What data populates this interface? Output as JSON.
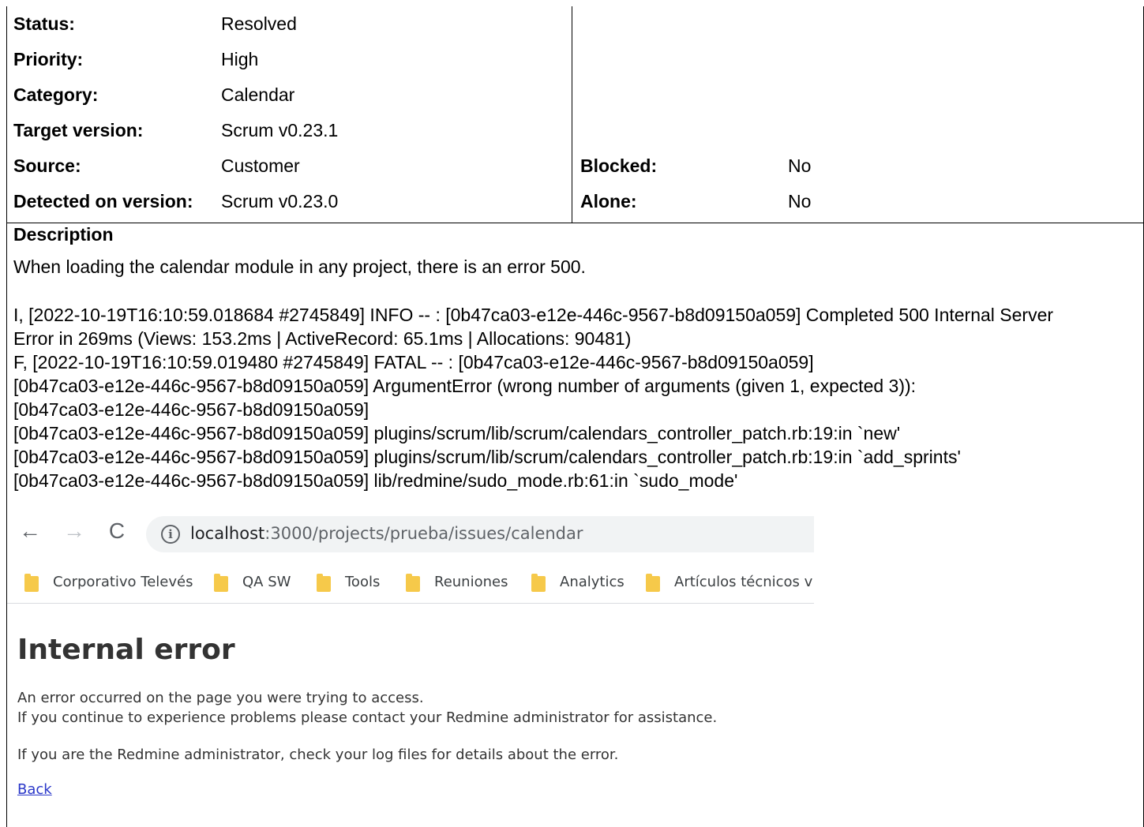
{
  "attributes_left": [
    {
      "label": "Status:",
      "value": "Resolved"
    },
    {
      "label": "Priority:",
      "value": "High"
    },
    {
      "label": "Category:",
      "value": "Calendar"
    },
    {
      "label": "Target version:",
      "value": "Scrum v0.23.1"
    },
    {
      "label": "Source:",
      "value": "Customer"
    },
    {
      "label": "Detected on version:",
      "value": "Scrum v0.23.0"
    }
  ],
  "attributes_right": [
    {
      "label": "Blocked:",
      "value": "No"
    },
    {
      "label": "Alone:",
      "value": "No"
    }
  ],
  "description": {
    "title": "Description",
    "intro": "When loading the calendar module in any project, there is an error 500.",
    "log_lines": [
      "I, [2022-10-19T16:10:59.018684 #2745849]  INFO -- : [0b47ca03-e12e-446c-9567-b8d09150a059] Completed 500 Internal Server",
      "Error in 269ms (Views: 153.2ms | ActiveRecord: 65.1ms | Allocations: 90481)",
      "F, [2022-10-19T16:10:59.019480 #2745849] FATAL -- : [0b47ca03-e12e-446c-9567-b8d09150a059]",
      "[0b47ca03-e12e-446c-9567-b8d09150a059] ArgumentError (wrong number of arguments (given 1, expected 3)):",
      "[0b47ca03-e12e-446c-9567-b8d09150a059]",
      "[0b47ca03-e12e-446c-9567-b8d09150a059] plugins/scrum/lib/scrum/calendars_controller_patch.rb:19:in `new'",
      "[0b47ca03-e12e-446c-9567-b8d09150a059] plugins/scrum/lib/scrum/calendars_controller_patch.rb:19:in `add_sprints'",
      "[0b47ca03-e12e-446c-9567-b8d09150a059] lib/redmine/sudo_mode.rb:61:in `sudo_mode'"
    ]
  },
  "screenshot": {
    "url_host": "localhost",
    "url_rest": ":3000/projects/prueba/issues/calendar",
    "bookmarks": [
      "Corporativo Televés",
      "QA SW",
      "Tools",
      "Reuniones",
      "Analytics",
      "Artículos técnicos v"
    ],
    "error_title": "Internal error",
    "error_line1": "An error occurred on the page you were trying to access.",
    "error_line2": "If you continue to experience problems please contact your Redmine administrator for assistance.",
    "error_line3": "If you are the Redmine administrator, check your log files for details about the error.",
    "back_link": "Back"
  }
}
